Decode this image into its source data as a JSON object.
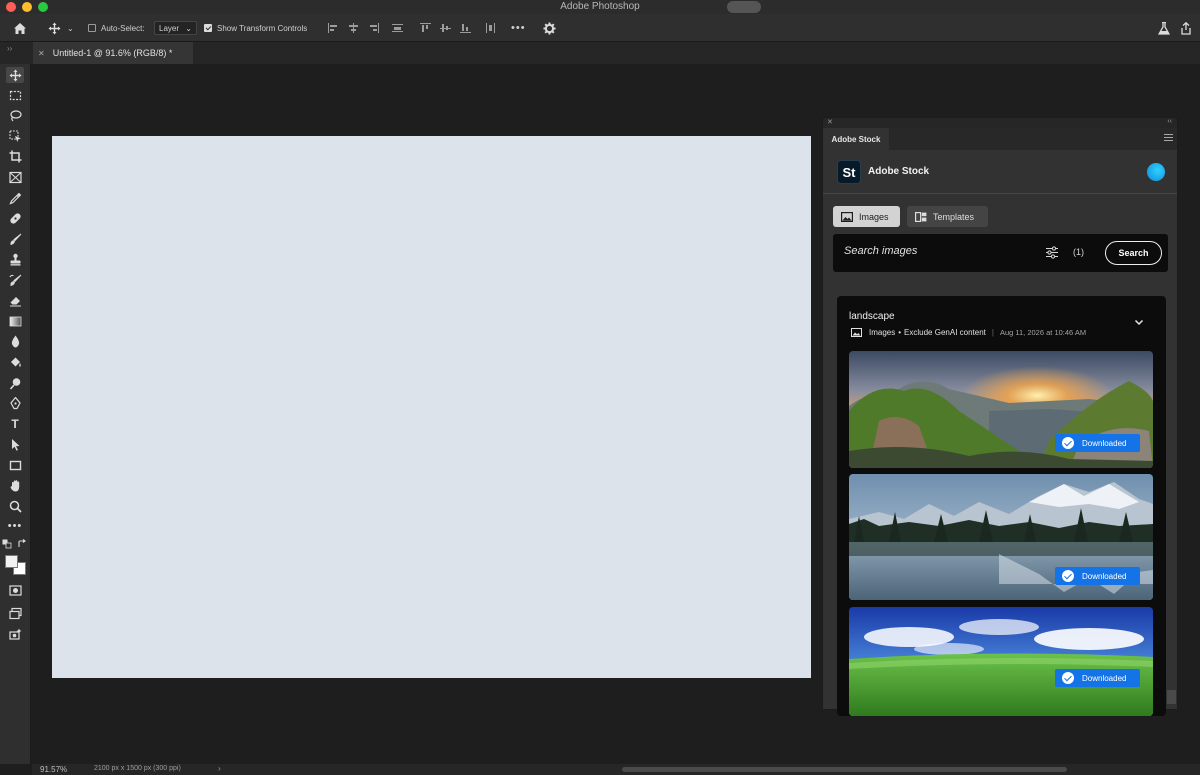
{
  "app": {
    "title": "Adobe Photoshop"
  },
  "options_bar": {
    "auto_select_label": "Auto-Select:",
    "auto_select_checked": false,
    "auto_select_target": "Layer",
    "show_transform_label": "Show Transform Controls",
    "show_transform_checked": true,
    "more_label": "•••"
  },
  "document": {
    "tab_title": "Untitled-1 @ 91.6% (RGB/8) *",
    "canvas_color": "#dde3ea"
  },
  "toolbar": {
    "type_tool_label": "T",
    "more_tools_label": "•••"
  },
  "status_bar": {
    "zoom": "91.57%",
    "doc_size": "2100 px x 1500 px (300 ppi)",
    "arrow": "›"
  },
  "stock_panel": {
    "tab_label": "Adobe Stock",
    "logo_text": "St",
    "title": "Adobe Stock",
    "types": [
      {
        "label": "Images",
        "selected": true
      },
      {
        "label": "Templates",
        "selected": false
      }
    ],
    "search": {
      "placeholder": "Search images",
      "filter_count": "(1)",
      "button_label": "Search"
    },
    "result_group": {
      "query": "landscape",
      "meta_type": "Images",
      "meta_bullet": "•",
      "meta_filter": "Exclude GenAI content",
      "meta_separator": "|",
      "meta_date": "Aug 11, 2026 at 10:46 AM",
      "thumbnails": [
        {
          "subject": "mountain ridge at sunset",
          "badge": "Downloaded"
        },
        {
          "subject": "snowy mountains reflected in lake",
          "badge": "Downloaded"
        },
        {
          "subject": "green meadow under blue sky",
          "badge": "Downloaded"
        }
      ]
    }
  },
  "colors": {
    "accent": "#1473e6",
    "panel_bg": "#323232",
    "workspace_bg": "#1e1e1e"
  }
}
